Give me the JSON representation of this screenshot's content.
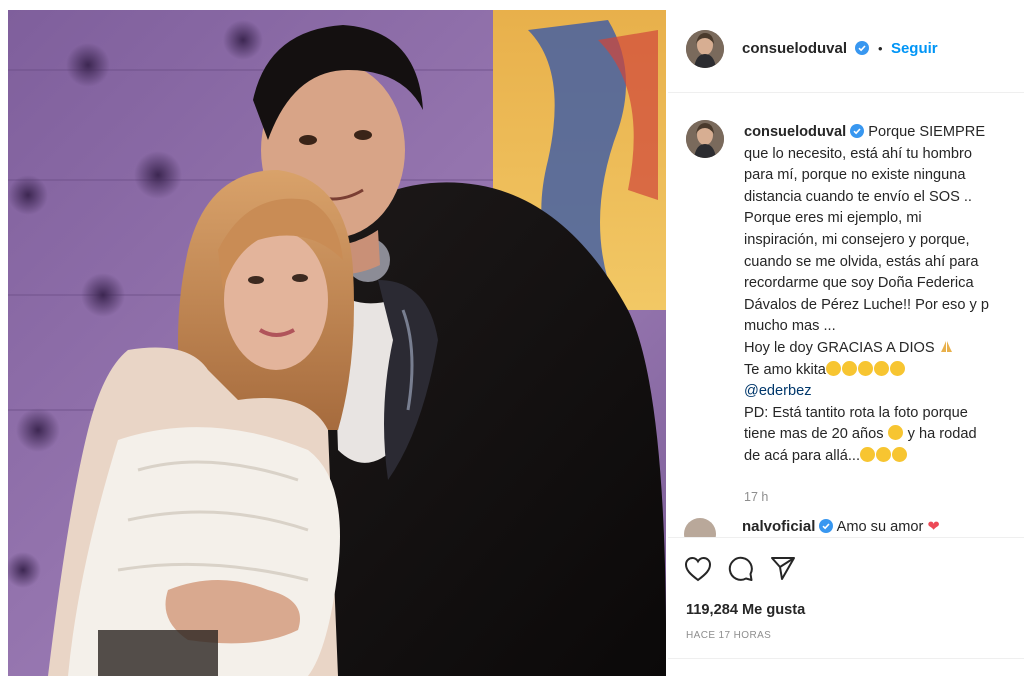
{
  "post": {
    "username": "consueloduval",
    "follow_label": "Seguir",
    "separator": "•",
    "caption_lines": [
      "Porque SIEMPRE",
      "que lo necesito, está ahí tu hombro",
      "para mí, porque no existe ninguna",
      "distancia cuando te envío el SOS ..",
      "Porque eres mi ejemplo, mi",
      "inspiración, mi consejero y porque,",
      "cuando se me olvida, estás ahí para",
      "recordarme que soy Doña Federica",
      "Dávalos de Pérez Luche!! Por eso y p",
      "mucho mas ...",
      "Hoy le doy GRACIAS A DIOS",
      "Te amo kkita",
      "@ederbez",
      "PD: Está tantito rota la foto porque",
      "tiene mas de 20 años",
      "y ha rodad",
      "de acá para allá..."
    ],
    "caption_time": "17 h",
    "next_comment_user": "nalvoficial",
    "next_comment_text": "Amo su amor",
    "likes": "119,284 Me gusta",
    "posted_ago": "HACE 17 HORAS"
  },
  "icons": {
    "verified": "verified-badge-icon",
    "like": "heart-outline-icon",
    "comment": "comment-bubble-icon",
    "share": "paper-plane-icon"
  },
  "colors": {
    "accent": "#0095f6",
    "verified": "#3897f0",
    "text": "#262626",
    "muted": "#8e8e8e",
    "mention": "#00376b"
  }
}
